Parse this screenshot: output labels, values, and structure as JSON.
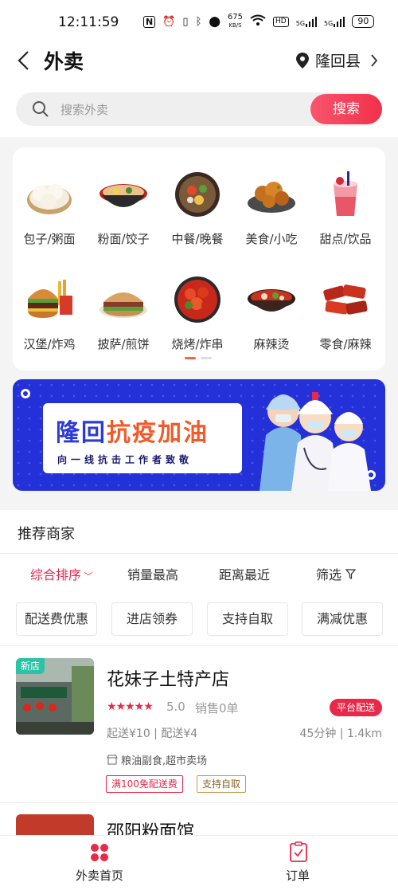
{
  "status_bar": {
    "time": "12:11:59",
    "network_speed": "675",
    "network_speed_unit": "KB/S",
    "battery": "90",
    "signal_1": "5G",
    "signal_2": "5G",
    "hd": "HD"
  },
  "header": {
    "title": "外卖",
    "location": "隆回县"
  },
  "search": {
    "placeholder": "搜索外卖",
    "button": "搜索"
  },
  "categories": [
    {
      "label": "包子/粥面",
      "icon": "steamed-bun-icon"
    },
    {
      "label": "粉面/饺子",
      "icon": "noodle-bowl-icon"
    },
    {
      "label": "中餐/晚餐",
      "icon": "hotpot-icon"
    },
    {
      "label": "美食/小吃",
      "icon": "fried-chicken-icon"
    },
    {
      "label": "甜点/饮品",
      "icon": "drink-cup-icon"
    },
    {
      "label": "汉堡/炸鸡",
      "icon": "burger-icon"
    },
    {
      "label": "披萨/煎饼",
      "icon": "flatbread-icon"
    },
    {
      "label": "烧烤/炸串",
      "icon": "crayfish-icon"
    },
    {
      "label": "麻辣烫",
      "icon": "spicy-soup-icon"
    },
    {
      "label": "零食/麻辣",
      "icon": "spicy-snack-icon"
    }
  ],
  "banner": {
    "headline_1": "隆回",
    "headline_2": "抗疫加油",
    "subline": "向一线抗击工作者致敬",
    "colors": {
      "background": "#2430d8",
      "accent": "#f25a2a"
    }
  },
  "recommend": {
    "title": "推荐商家",
    "sort_options": [
      "综合排序",
      "销量最高",
      "距离最近",
      "筛选"
    ],
    "filters": [
      "配送费优惠",
      "进店领券",
      "支持自取",
      "满减优惠"
    ]
  },
  "shops": [
    {
      "badge": "新店",
      "name": "花妹子土特产店",
      "stars": "★★★★★",
      "rating": "5.0",
      "sales": "销售0单",
      "delivery_tag": "平台配送",
      "fee": "起送¥10 | 配送¥4",
      "distance": "45分钟 | 1.4km",
      "category": "粮油副食,超市卖场",
      "tags": [
        "满100免配送费",
        "支持自取"
      ]
    },
    {
      "name": "邵阳粉面馆"
    }
  ],
  "tabbar": {
    "home": "外卖首页",
    "orders": "订单"
  },
  "colors": {
    "brand": "#e8294a",
    "new_badge": "#28c4a5"
  }
}
